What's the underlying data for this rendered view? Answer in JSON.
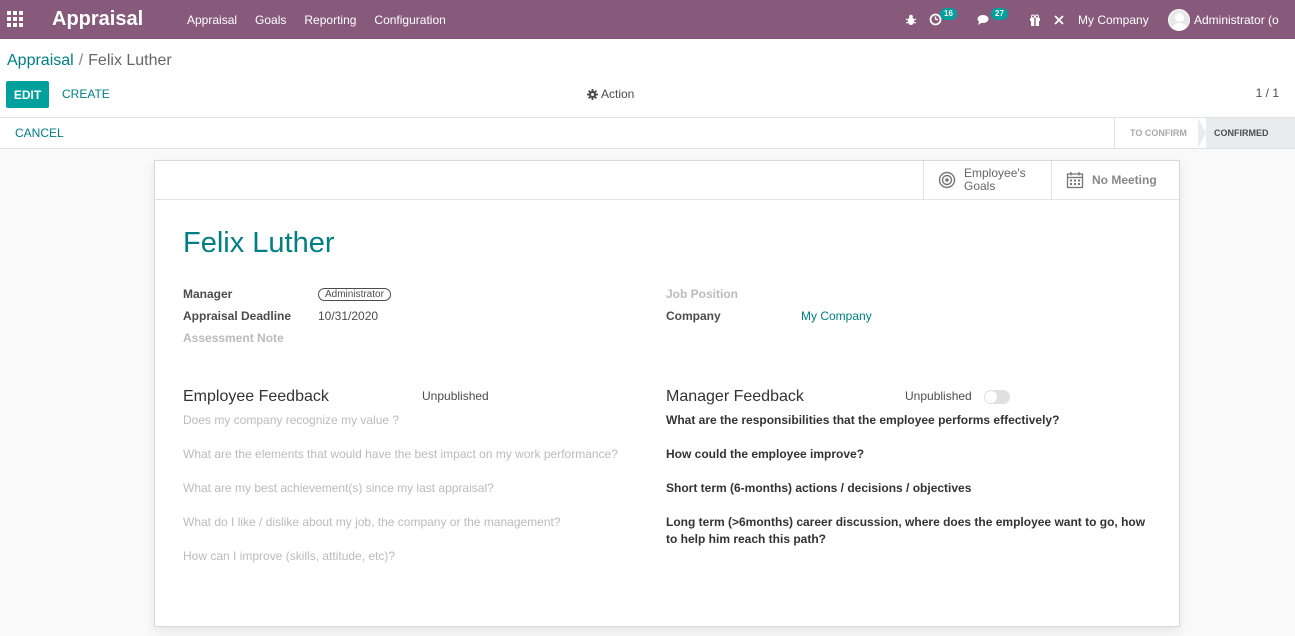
{
  "navbar": {
    "app_name": "Appraisal",
    "menu": [
      "Appraisal",
      "Goals",
      "Reporting",
      "Configuration"
    ],
    "activity_count": "16",
    "message_count": "27",
    "company": "My Company",
    "user": "Administrator (o",
    "bg_color": "#875a7b",
    "badge_color": "#00a09d"
  },
  "control_panel": {
    "breadcrumb_parent": "Appraisal",
    "breadcrumb_sep": "/",
    "breadcrumb_current": "Felix Luther",
    "edit_label": "EDIT",
    "create_label": "CREATE",
    "action_label": "Action",
    "pager": "1 / 1"
  },
  "statusbar": {
    "cancel_label": "CANCEL",
    "stages": [
      "TO CONFIRM",
      "CONFIRMED"
    ],
    "active_stage": "CONFIRMED"
  },
  "smart_buttons": {
    "goals_line1": "Employee's",
    "goals_line2": "Goals",
    "meeting_label": "No Meeting"
  },
  "form": {
    "title": "Felix Luther",
    "manager_label": "Manager",
    "manager_value": "Administrator",
    "deadline_label": "Appraisal Deadline",
    "deadline_value": "10/31/2020",
    "assessment_label": "Assessment Note",
    "job_label": "Job Position",
    "company_label": "Company",
    "company_value": "My Company"
  },
  "employee_feedback": {
    "title": "Employee Feedback",
    "status": "Unpublished",
    "questions": [
      "Does my company recognize my value ?",
      "What are the elements that would have the best impact on my work performance?",
      "What are my best achievement(s) since my last appraisal?",
      "What do I like / dislike about my job, the company or the management?",
      "How can I improve (skills, attitude, etc)?"
    ]
  },
  "manager_feedback": {
    "title": "Manager Feedback",
    "status": "Unpublished",
    "published": false,
    "questions": [
      "What are the responsibilities that the employee performs effectively?",
      "How could the employee improve?",
      "Short term (6-months) actions / decisions / objectives",
      "Long term (>6months) career discussion, where does the employee want to go, how",
      "to help him reach this path?"
    ]
  }
}
